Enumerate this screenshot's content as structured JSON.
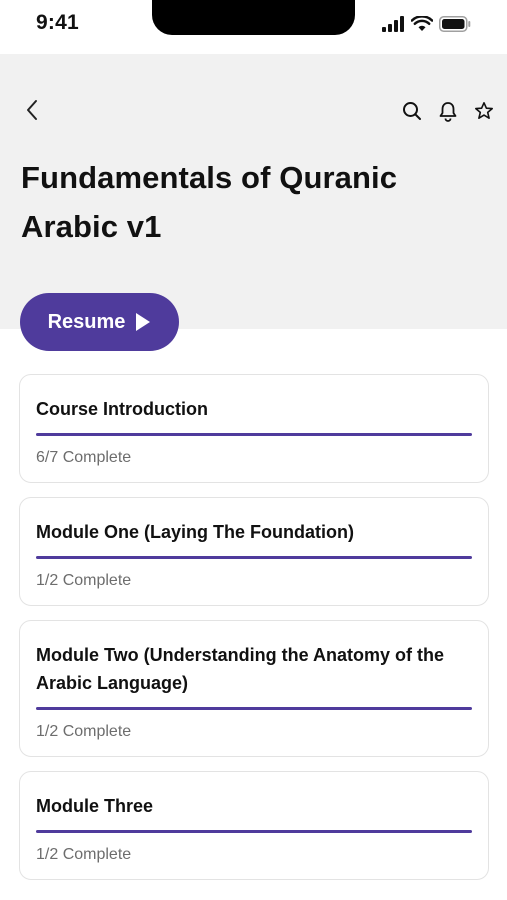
{
  "status_bar": {
    "time": "9:41"
  },
  "page": {
    "title": "Fundamentals of Quranic Arabic v1"
  },
  "actions": {
    "resume_label": "Resume"
  },
  "icons": {
    "back": "chevron-left-icon",
    "search": "search-icon",
    "bell": "bell-icon",
    "star": "star-icon",
    "play": "play-icon"
  },
  "colors": {
    "accent": "#4f3b9c",
    "header_bg": "#f1f1f1"
  },
  "modules": [
    {
      "title": "Course Introduction",
      "status": "6/7 Complete",
      "progress": 1.0
    },
    {
      "title": "Module One (Laying The Foundation)",
      "status": "1/2 Complete",
      "progress": 1.0
    },
    {
      "title": "Module Two (Understanding the Anatomy of the Arabic Language)",
      "status": "1/2 Complete",
      "progress": 1.0
    },
    {
      "title": "Module Three",
      "status": "1/2 Complete",
      "progress": 1.0
    }
  ]
}
